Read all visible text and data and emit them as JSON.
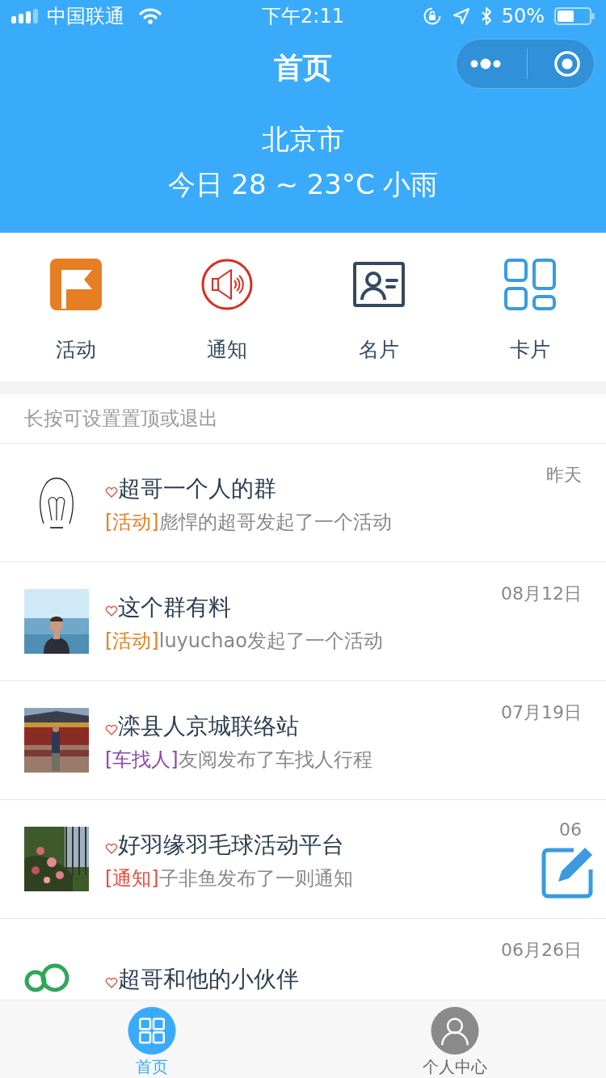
{
  "status_bar": {
    "carrier": "中国联通",
    "time": "下午2:11",
    "battery": "50%"
  },
  "nav": {
    "title": "首页"
  },
  "weather": {
    "city": "北京市",
    "forecast": "今日 28 ~ 23°C 小雨"
  },
  "shortcuts": [
    {
      "kind": "flag",
      "label": "活动"
    },
    {
      "kind": "speaker",
      "label": "通知"
    },
    {
      "kind": "card",
      "label": "名片"
    },
    {
      "kind": "grid",
      "label": "卡片"
    }
  ],
  "hint": "长按可设置置顶或退出",
  "groups": [
    {
      "title": "超哥一个人的群",
      "tag": "[活动]",
      "color": "#e67e22",
      "message": "彪悍的超哥发起了一个活动",
      "date": "昨天"
    },
    {
      "title": "这个群有料",
      "tag": "[活动]",
      "color": "#e67e22",
      "message": "luyuchao发起了一个活动",
      "date": "08月12日"
    },
    {
      "title": "滦县人京城联络站",
      "tag": "[车找人]",
      "color": "#8e44ad",
      "message": "友阅发布了车找人行程",
      "date": "07月19日"
    },
    {
      "title": "好羽缘羽毛球活动平台",
      "tag": "[通知]",
      "color": "#e74c3c",
      "message": "子非鱼发布了一则通知",
      "date": "06"
    },
    {
      "title": "超哥和他的小伙伴",
      "date": "06月26日"
    }
  ],
  "tabs": [
    {
      "label": "首页",
      "kind": "home",
      "selected": true
    },
    {
      "label": "个人中心",
      "kind": "person",
      "selected": false
    }
  ]
}
